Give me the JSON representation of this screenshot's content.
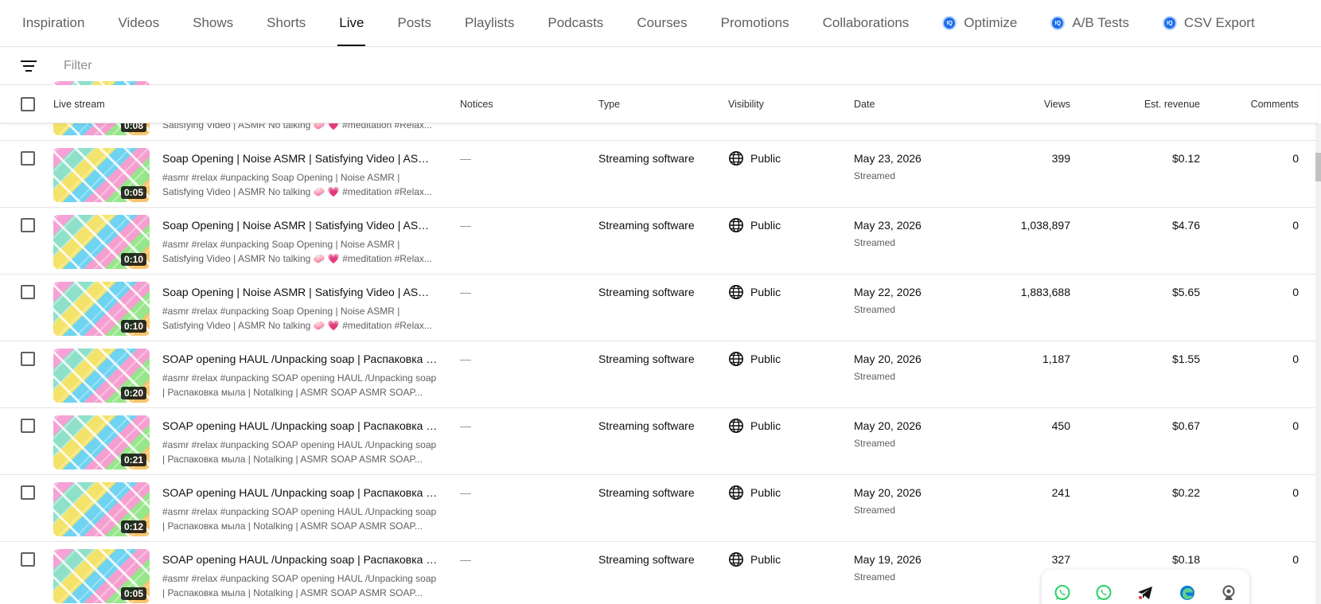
{
  "tabs": [
    {
      "label": "Inspiration",
      "active": false,
      "vq": false
    },
    {
      "label": "Videos",
      "active": false,
      "vq": false
    },
    {
      "label": "Shows",
      "active": false,
      "vq": false
    },
    {
      "label": "Shorts",
      "active": false,
      "vq": false
    },
    {
      "label": "Live",
      "active": true,
      "vq": false
    },
    {
      "label": "Posts",
      "active": false,
      "vq": false
    },
    {
      "label": "Playlists",
      "active": false,
      "vq": false
    },
    {
      "label": "Podcasts",
      "active": false,
      "vq": false
    },
    {
      "label": "Courses",
      "active": false,
      "vq": false
    },
    {
      "label": "Promotions",
      "active": false,
      "vq": false
    },
    {
      "label": "Collaborations",
      "active": false,
      "vq": false
    },
    {
      "label": "Optimize",
      "active": false,
      "vq": true
    },
    {
      "label": "A/B Tests",
      "active": false,
      "vq": true
    },
    {
      "label": "CSV Export",
      "active": false,
      "vq": true
    }
  ],
  "vq_badge_text": "IQ",
  "filter": {
    "placeholder": "Filter"
  },
  "columns": {
    "live_stream": "Live stream",
    "notices": "Notices",
    "type": "Type",
    "visibility": "Visibility",
    "date": "Date",
    "views": "Views",
    "est_revenue": "Est. revenue",
    "comments": "Comments"
  },
  "partial_row": {
    "duration": "0:08",
    "desc_tail": "Satisfying Video | ASMR No talking 🧼 💗 #meditation #Relax..."
  },
  "rows": [
    {
      "duration": "0:05",
      "title": "Soap Opening | Noise ASMR | Satisfying Video | ASMR No talking",
      "desc": "#asmr #relax #unpacking Soap Opening | Noise ASMR | Satisfying Video | ASMR No talking 🧼 💗 #meditation #Relax...",
      "notice": "—",
      "type": "Streaming software",
      "visibility": "Public",
      "date": "May 23, 2026",
      "date_sub": "Streamed",
      "views": "399",
      "revenue": "$0.12",
      "comments": "0"
    },
    {
      "duration": "0:10",
      "title": "Soap Opening | Noise ASMR | Satisfying Video | ASMR No talking",
      "desc": "#asmr #relax #unpacking Soap Opening | Noise ASMR | Satisfying Video | ASMR No talking 🧼 💗 #meditation #Relax...",
      "notice": "—",
      "type": "Streaming software",
      "visibility": "Public",
      "date": "May 23, 2026",
      "date_sub": "Streamed",
      "views": "1,038,897",
      "revenue": "$4.76",
      "comments": "0"
    },
    {
      "duration": "0:10",
      "title": "Soap Opening | Noise ASMR | Satisfying Video | ASMR No talking",
      "desc": "#asmr #relax #unpacking Soap Opening | Noise ASMR | Satisfying Video | ASMR No talking 🧼 💗 #meditation #Relax...",
      "notice": "—",
      "type": "Streaming software",
      "visibility": "Public",
      "date": "May 22, 2026",
      "date_sub": "Streamed",
      "views": "1,883,688",
      "revenue": "$5.65",
      "comments": "0"
    },
    {
      "duration": "0:20",
      "title": "SOAP opening HAUL /Unpacking soap | Распаковка мыла",
      "desc": "#asmr #relax #unpacking SOAP opening HAUL /Unpacking soap | Распаковка мыла | Notalking | ASMR SOAP ASMR SOAP...",
      "notice": "—",
      "type": "Streaming software",
      "visibility": "Public",
      "date": "May 20, 2026",
      "date_sub": "Streamed",
      "views": "1,187",
      "revenue": "$1.55",
      "comments": "0"
    },
    {
      "duration": "0:21",
      "title": "SOAP opening HAUL /Unpacking soap | Распаковка мыла",
      "desc": "#asmr #relax #unpacking SOAP opening HAUL /Unpacking soap | Распаковка мыла | Notalking | ASMR SOAP ASMR SOAP...",
      "notice": "—",
      "type": "Streaming software",
      "visibility": "Public",
      "date": "May 20, 2026",
      "date_sub": "Streamed",
      "views": "450",
      "revenue": "$0.67",
      "comments": "0"
    },
    {
      "duration": "0:12",
      "title": "SOAP opening HAUL /Unpacking soap | Распаковка мыла",
      "desc": "#asmr #relax #unpacking SOAP opening HAUL /Unpacking soap | Распаковка мыла | Notalking | ASMR SOAP ASMR SOAP...",
      "notice": "—",
      "type": "Streaming software",
      "visibility": "Public",
      "date": "May 20, 2026",
      "date_sub": "Streamed",
      "views": "241",
      "revenue": "$0.22",
      "comments": "0"
    },
    {
      "duration": "0:05",
      "title": "SOAP opening HAUL /Unpacking soap | Распаковка мыла",
      "desc": "#asmr #relax #unpacking SOAP opening HAUL /Unpacking soap | Распаковка мыла | Notalking | ASMR SOAP ASMR SOAP...",
      "notice": "—",
      "type": "Streaming software",
      "visibility": "Public",
      "date": "May 19, 2026",
      "date_sub": "Streamed",
      "views": "327",
      "revenue": "$0.18",
      "comments": "0"
    }
  ],
  "dock": [
    {
      "name": "whatsapp-icon",
      "color": "#25d366"
    },
    {
      "name": "whatsapp-business-icon",
      "color": "#25d366"
    },
    {
      "name": "telegram-icon",
      "color": "#111111"
    },
    {
      "name": "edge-icon",
      "color": "#0c7bd8"
    },
    {
      "name": "webcam-icon",
      "color": "#555555"
    }
  ]
}
